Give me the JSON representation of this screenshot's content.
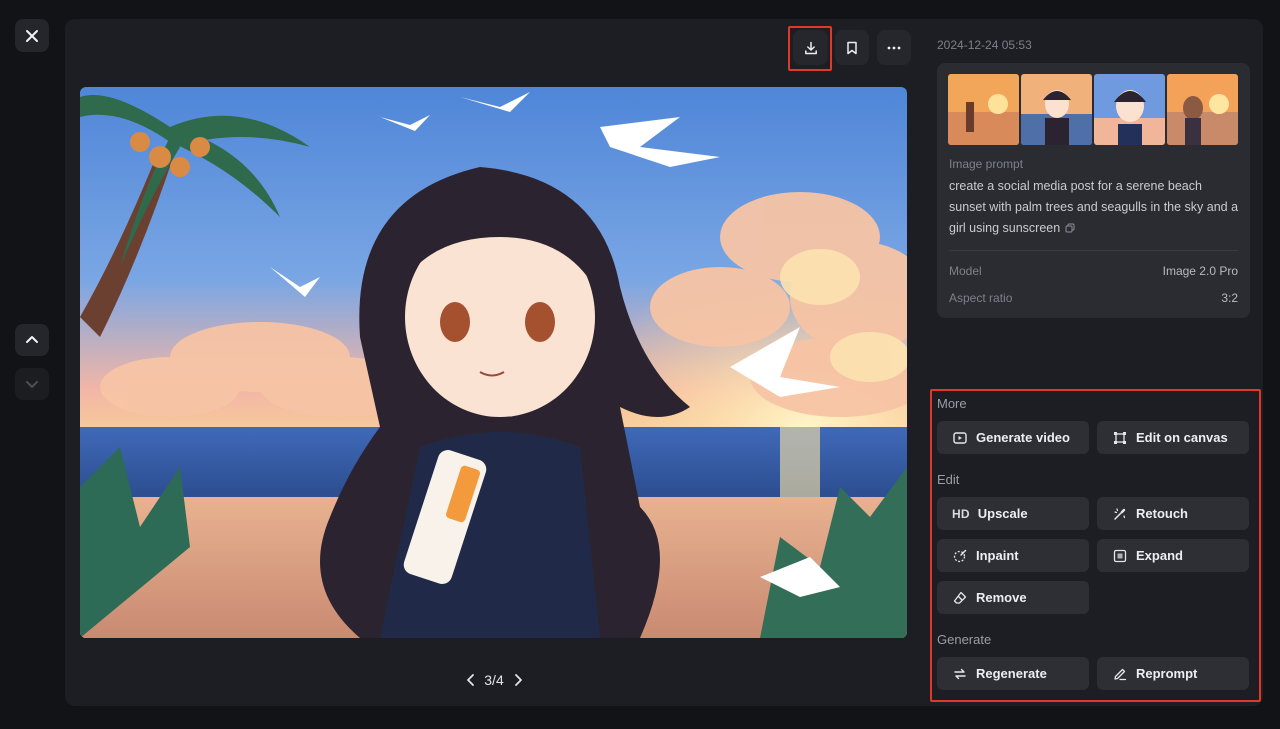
{
  "toolbar": {
    "close_icon": "close-icon",
    "download_icon": "download-icon",
    "bookmark_icon": "bookmark-icon",
    "more_icon": "more-icon"
  },
  "nav": {
    "up_icon": "chevron-up-icon",
    "down_icon": "chevron-down-icon"
  },
  "pager": {
    "label": "3/4"
  },
  "details": {
    "timestamp": "2024-12-24 05:53",
    "prompt_label": "Image prompt",
    "prompt_text": "create a social media post for a serene beach sunset with palm trees and seagulls in the sky and a girl using sunscreen",
    "model_label": "Model",
    "model_value": "Image 2.0 Pro",
    "aspect_label": "Aspect ratio",
    "aspect_value": "3:2"
  },
  "sections": {
    "more": "More",
    "edit": "Edit",
    "generate": "Generate"
  },
  "actions": {
    "generate_video": "Generate video",
    "edit_on_canvas": "Edit on canvas",
    "upscale_prefix": "HD",
    "upscale": "Upscale",
    "retouch": "Retouch",
    "inpaint": "Inpaint",
    "expand": "Expand",
    "remove": "Remove",
    "regenerate": "Regenerate",
    "reprompt": "Reprompt"
  },
  "colors": {
    "page_bg": "#121317",
    "panel_bg": "#1c1e23",
    "card_bg": "#2a2c32",
    "button_bg": "#2d2f35",
    "highlight": "#e0392b"
  }
}
